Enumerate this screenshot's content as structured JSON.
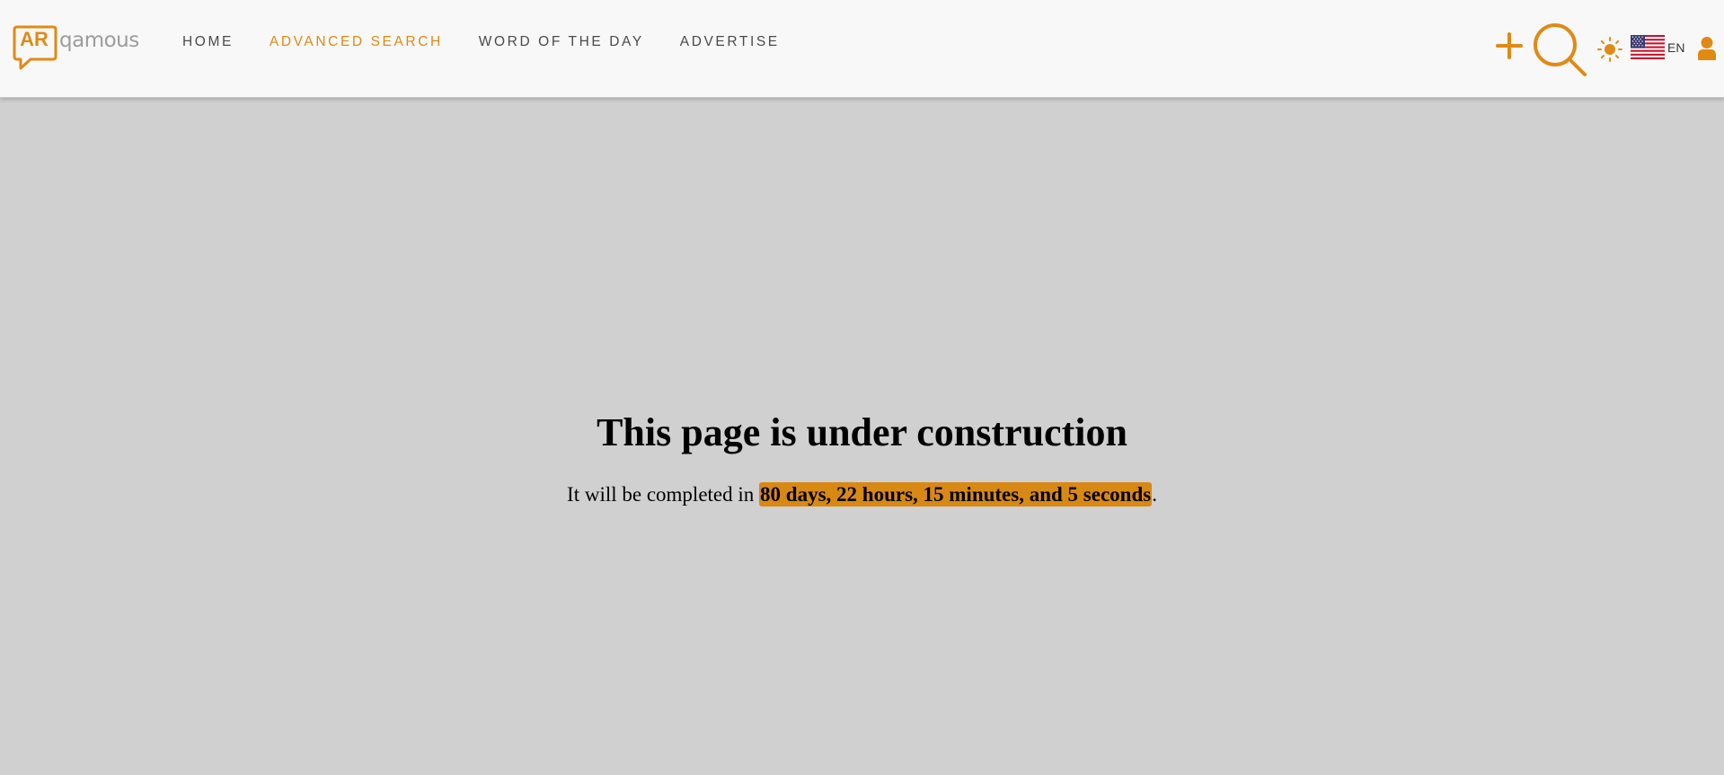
{
  "brand": {
    "badge": "AR",
    "name": "qamous"
  },
  "nav": {
    "items": [
      {
        "label": "HOME",
        "active": false
      },
      {
        "label": "ADVANCED SEARCH",
        "active": true
      },
      {
        "label": "WORD OF THE DAY",
        "active": false
      },
      {
        "label": "ADVERTISE",
        "active": false
      }
    ]
  },
  "toolbar": {
    "add_icon": "plus-icon",
    "search_icon": "search-icon",
    "theme_icon": "sun-icon",
    "language_flag_icon": "us-flag-icon",
    "language": "EN",
    "user_icon": "user-icon"
  },
  "main": {
    "heading": "This page is under construction",
    "message_prefix": "It will be completed in ",
    "countdown": "80 days, 22 hours, 15 minutes, and 5 seconds",
    "message_suffix": "."
  },
  "colors": {
    "accent": "#e08a14",
    "highlight": "#d88914",
    "navbar_bg": "#f8f8f8",
    "page_bg": "#d0d0d0",
    "nav_text": "#4a4a4a"
  }
}
